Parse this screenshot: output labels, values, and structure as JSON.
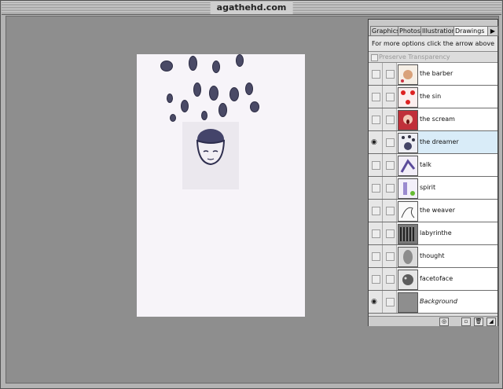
{
  "window": {
    "title": "agathehd.com"
  },
  "panel": {
    "tabs": [
      {
        "label": "Graphics",
        "active": false
      },
      {
        "label": "Photos",
        "active": false
      },
      {
        "label": "Illustrations",
        "active": false
      },
      {
        "label": "Drawings",
        "active": true
      }
    ],
    "menu_arrow": "▶",
    "options_text": "For more options click the arrow above",
    "preserve_transparency": "Preserve Transparency",
    "layers": [
      {
        "name": "the barber",
        "visible": false,
        "selected": false
      },
      {
        "name": "the sin",
        "visible": false,
        "selected": false
      },
      {
        "name": "the scream",
        "visible": false,
        "selected": false
      },
      {
        "name": "the dreamer",
        "visible": true,
        "selected": true
      },
      {
        "name": "talk",
        "visible": false,
        "selected": false
      },
      {
        "name": "spirit",
        "visible": false,
        "selected": false
      },
      {
        "name": "the weaver",
        "visible": false,
        "selected": false
      },
      {
        "name": "labyrinthe",
        "visible": false,
        "selected": false
      },
      {
        "name": "thought",
        "visible": false,
        "selected": false
      },
      {
        "name": "facetoface",
        "visible": false,
        "selected": false
      },
      {
        "name": "Background",
        "visible": true,
        "selected": false,
        "italic": true
      }
    ],
    "icons": {
      "visibility": "eye-icon",
      "new_layer": "new-layer-icon",
      "delete": "trash-icon",
      "mask": "mask-icon",
      "resize": "resize-grip-icon"
    }
  }
}
